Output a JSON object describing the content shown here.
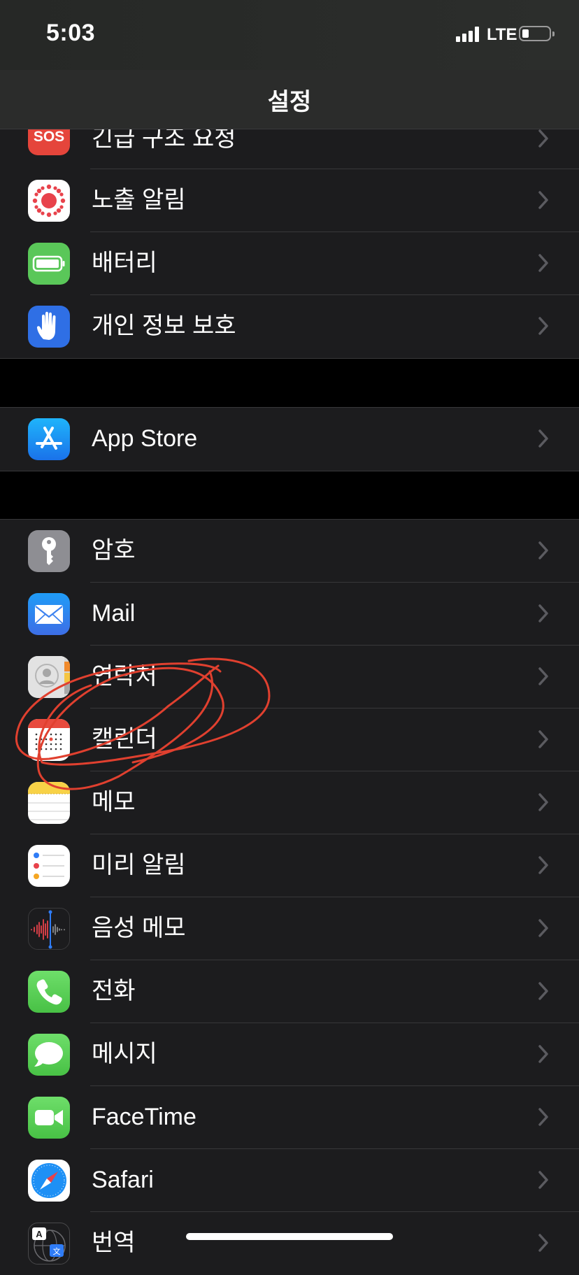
{
  "status_bar": {
    "time": "5:03",
    "network": "LTE"
  },
  "nav": {
    "title": "설정"
  },
  "groups": [
    {
      "items": [
        {
          "label": "긴급 구조 요청",
          "icon": "sos-icon",
          "icon_text": "SOS",
          "color": "#e5453b"
        },
        {
          "label": "노출 알림",
          "icon": "exposure-notification-icon",
          "color": "#ffffff"
        },
        {
          "label": "배터리",
          "icon": "battery-icon",
          "color": "#5ac759"
        },
        {
          "label": "개인 정보 보호",
          "icon": "hand-icon",
          "color": "#2f6fe5"
        }
      ]
    },
    {
      "items": [
        {
          "label": "App Store",
          "icon": "app-store-icon",
          "color": "#1e8ff3"
        }
      ]
    },
    {
      "items": [
        {
          "label": "암호",
          "icon": "key-icon",
          "color": "#8e8e93"
        },
        {
          "label": "Mail",
          "icon": "mail-icon",
          "color": "#3a8ef0"
        },
        {
          "label": "연락처",
          "icon": "contacts-icon",
          "color": "#d9d9d9"
        },
        {
          "label": "캘린더",
          "icon": "calendar-icon",
          "color": "#ffffff"
        },
        {
          "label": "메모",
          "icon": "notes-icon",
          "color": "#ffffff"
        },
        {
          "label": "미리 알림",
          "icon": "reminders-icon",
          "color": "#ffffff"
        },
        {
          "label": "음성 메모",
          "icon": "voice-memos-icon",
          "color": "#1c1c1e"
        },
        {
          "label": "전화",
          "icon": "phone-icon",
          "color": "#5ac759"
        },
        {
          "label": "메시지",
          "icon": "messages-icon",
          "color": "#5ac759"
        },
        {
          "label": "FaceTime",
          "icon": "facetime-icon",
          "color": "#5ac759"
        },
        {
          "label": "Safari",
          "icon": "safari-icon",
          "color": "#ffffff"
        },
        {
          "label": "번역",
          "icon": "translate-icon",
          "icon_text": "A 文",
          "color": "#1c1c1e"
        }
      ]
    }
  ],
  "annotation": {
    "color": "#e0402f",
    "target": "캘린더"
  }
}
